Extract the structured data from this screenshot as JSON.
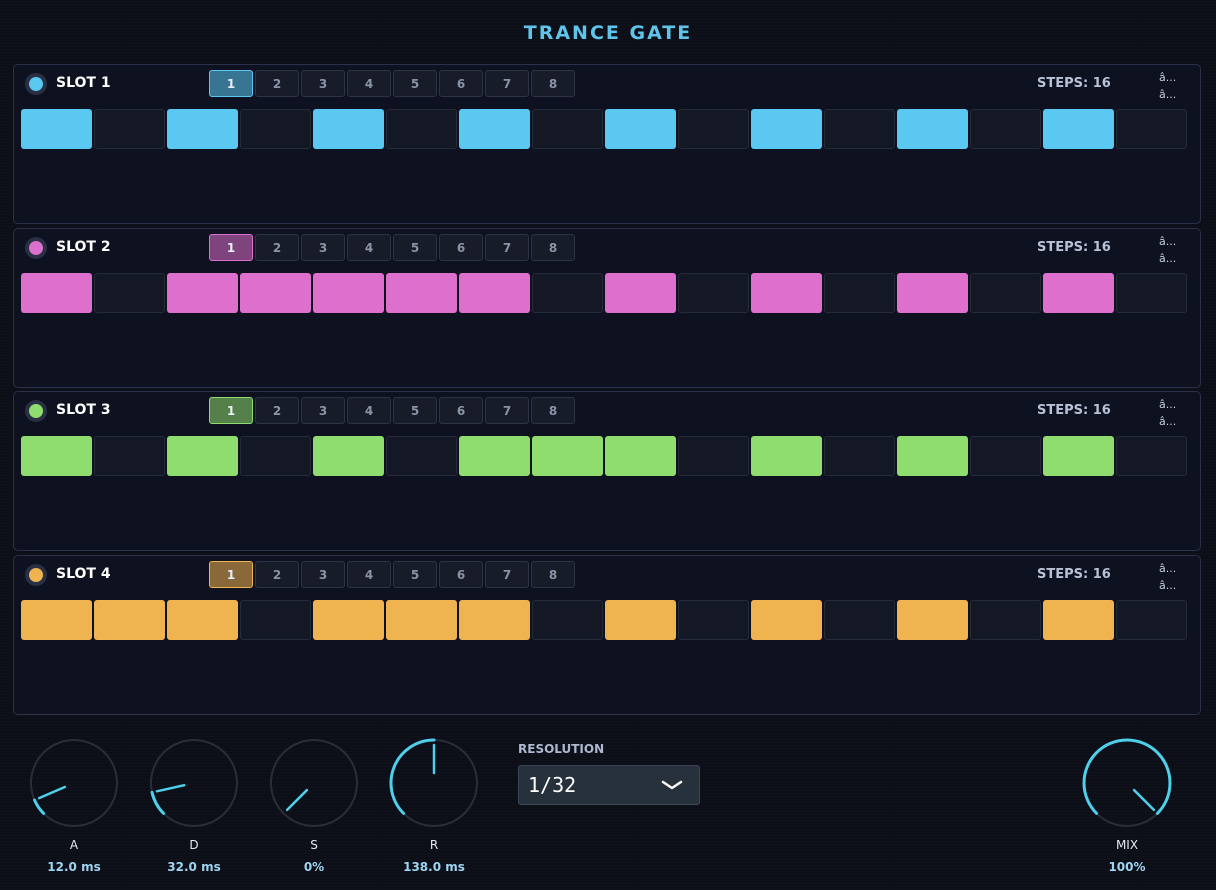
{
  "title": "TRANCE GATE",
  "pattern_tabs": [
    "1",
    "2",
    "3",
    "4",
    "5",
    "6",
    "7",
    "8"
  ],
  "slots": [
    {
      "name": "SLOT 1",
      "color": "#5bc8f2",
      "steps_label": "STEPS: 16",
      "arrows": [
        "â...",
        "â..."
      ],
      "active_pattern": "1",
      "steps": [
        1,
        0,
        1,
        0,
        1,
        0,
        1,
        0,
        1,
        0,
        1,
        0,
        1,
        0,
        1,
        0
      ]
    },
    {
      "name": "SLOT 2",
      "color": "#dd70cc",
      "steps_label": "STEPS: 16",
      "arrows": [
        "â...",
        "â..."
      ],
      "active_pattern": "1",
      "steps": [
        1,
        0,
        1,
        1,
        1,
        1,
        1,
        0,
        1,
        0,
        1,
        0,
        1,
        0,
        1,
        0
      ]
    },
    {
      "name": "SLOT 3",
      "color": "#8fdd6e",
      "steps_label": "STEPS: 16",
      "arrows": [
        "â...",
        "â..."
      ],
      "active_pattern": "1",
      "steps": [
        1,
        0,
        1,
        0,
        1,
        0,
        1,
        1,
        1,
        0,
        1,
        0,
        1,
        0,
        1,
        0
      ]
    },
    {
      "name": "SLOT 4",
      "color": "#efb350",
      "steps_label": "STEPS: 16",
      "arrows": [
        "â...",
        "â..."
      ],
      "active_pattern": "1",
      "steps": [
        1,
        1,
        1,
        0,
        1,
        1,
        1,
        0,
        1,
        0,
        1,
        0,
        1,
        0,
        1,
        0
      ]
    }
  ],
  "knobs": [
    {
      "label": "A",
      "value": "12.0 ms",
      "level": 0.08
    },
    {
      "label": "D",
      "value": "32.0 ms",
      "level": 0.12
    },
    {
      "label": "S",
      "value": "0%",
      "level": 0.0
    },
    {
      "label": "R",
      "value": "138.0 ms",
      "level": 0.5
    },
    {
      "label": "MIX",
      "value": "100%",
      "level": 1.0
    }
  ],
  "resolution": {
    "label": "RESOLUTION",
    "value": "1/32"
  },
  "colors": {
    "accent": "#5fc4ea",
    "knob_arc": "#4fd0ea",
    "knob_ring": "#2a2e3a"
  }
}
